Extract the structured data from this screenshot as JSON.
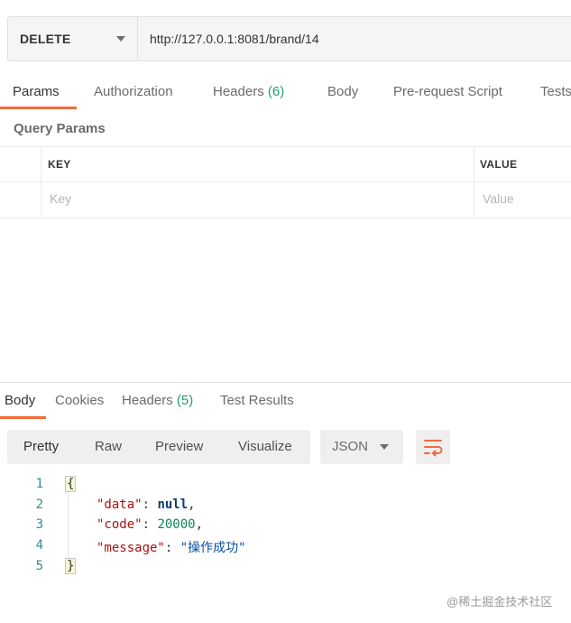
{
  "request": {
    "method": "DELETE",
    "url": "http://127.0.0.1:8081/brand/14"
  },
  "request_tabs": [
    {
      "label": "Params",
      "count": ""
    },
    {
      "label": "Authorization",
      "count": ""
    },
    {
      "label": "Headers",
      "count": "(6)"
    },
    {
      "label": "Body",
      "count": ""
    },
    {
      "label": "Pre-request Script",
      "count": ""
    },
    {
      "label": "Tests",
      "count": ""
    }
  ],
  "query_params": {
    "title": "Query Params",
    "columns": [
      "KEY",
      "VALUE"
    ],
    "placeholders": {
      "key": "Key",
      "value": "Value"
    }
  },
  "response_tabs": [
    {
      "label": "Body",
      "count": ""
    },
    {
      "label": "Cookies",
      "count": ""
    },
    {
      "label": "Headers",
      "count": "(5)"
    },
    {
      "label": "Test Results",
      "count": ""
    }
  ],
  "view_modes": [
    "Pretty",
    "Raw",
    "Preview",
    "Visualize"
  ],
  "format": "JSON",
  "response_body": {
    "line_numbers": [
      "1",
      "2",
      "3",
      "4",
      "5"
    ],
    "open_brace": "{",
    "close_brace": "}",
    "fields": [
      {
        "key": "\"data\"",
        "value": "null",
        "kind": "keyword"
      },
      {
        "key": "\"code\"",
        "value": "20000",
        "kind": "number"
      },
      {
        "key": "\"message\"",
        "value": "\"操作成功\"",
        "kind": "string"
      }
    ]
  },
  "watermark": "@稀土掘金技术社区",
  "colors": {
    "accent": "#f26b3a",
    "count": "#22a06b"
  }
}
